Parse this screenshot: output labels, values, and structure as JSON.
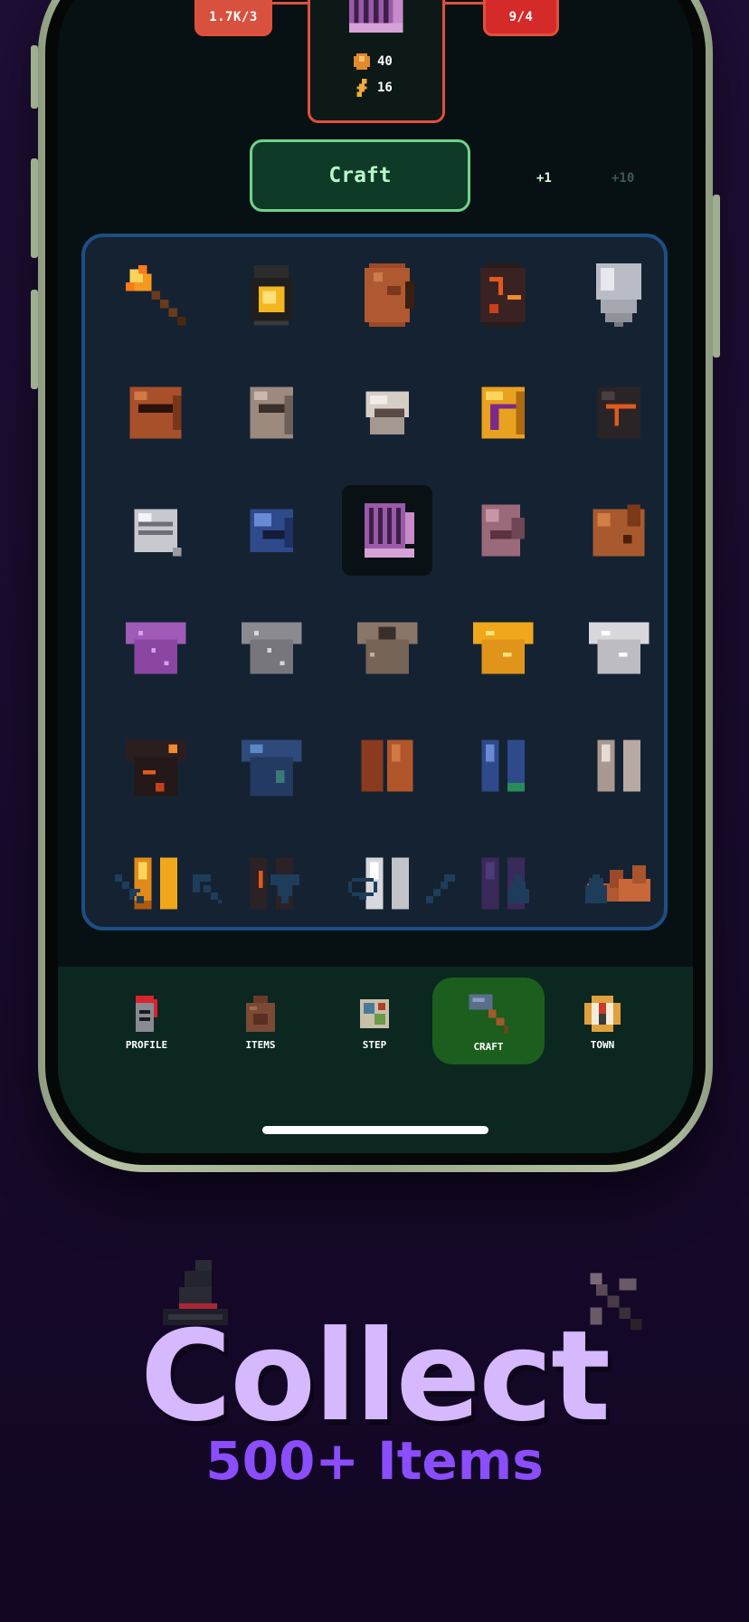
{
  "recipe": {
    "ingredient_left": {
      "label": "1.7K/3",
      "icon": "coal-ore-icon",
      "color": "#d8513e"
    },
    "ingredient_right": {
      "label": "9/4",
      "icon": "purple-ingot-icon",
      "color": "#d52a2a"
    },
    "result_icon": "purple-greathelm-icon",
    "costs": [
      {
        "icon": "coin-icon",
        "value": "40"
      },
      {
        "icon": "energy-icon",
        "value": "16"
      }
    ]
  },
  "craft_button": {
    "label": "Craft"
  },
  "quantity_options": [
    "+1",
    "+10"
  ],
  "item_grid": [
    [
      "torch-icon",
      "lantern-icon",
      "wooden-shield-icon",
      "magma-shield-icon",
      "steel-shield-icon"
    ],
    [
      "bronze-helm-icon",
      "iron-helm-icon",
      "silver-helm-icon",
      "golden-helm-icon",
      "obsidian-helm-icon"
    ],
    [
      "steel-visor-helm-icon",
      "sapphire-helm-icon",
      "purple-greathelm-icon",
      "rose-helm-icon",
      "copper-helm-icon"
    ],
    [
      "amethyst-chainmail-icon",
      "iron-chainmail-icon",
      "bronze-chainmail-icon",
      "golden-chainmail-icon",
      "silver-chainmail-icon"
    ],
    [
      "magma-armor-icon",
      "sapphire-armor-icon",
      "copper-greaves-icon",
      "sapphire-greaves-icon",
      "silver-greaves-icon"
    ],
    [
      "golden-greaves-icon",
      "obsidian-greaves-icon",
      "steel-greaves-icon",
      "amethyst-greaves-icon",
      "leather-boots-icon"
    ]
  ],
  "selected_item": "purple-greathelm-icon",
  "categories": [
    "sword-icon",
    "pickaxe-icon",
    "anvil-icon",
    "ring-icon",
    "wand-icon",
    "potion-icon",
    "bag-icon"
  ],
  "tabs": [
    {
      "label": "PROFILE",
      "icon": "knight-helmet-icon"
    },
    {
      "label": "ITEMS",
      "icon": "backpack-icon"
    },
    {
      "label": "STEP",
      "icon": "map-icon"
    },
    {
      "label": "CRAFT",
      "icon": "hammer-icon"
    },
    {
      "label": "TOWN",
      "icon": "compass-icon"
    }
  ],
  "active_tab": "CRAFT",
  "headline": "Collect",
  "subheadline": "500+ Items",
  "colors": {
    "accent_green": "#6fd38b",
    "headline": "#d5b8ff",
    "subheadline": "#8a4dff",
    "panel_border": "#1d4f86"
  }
}
